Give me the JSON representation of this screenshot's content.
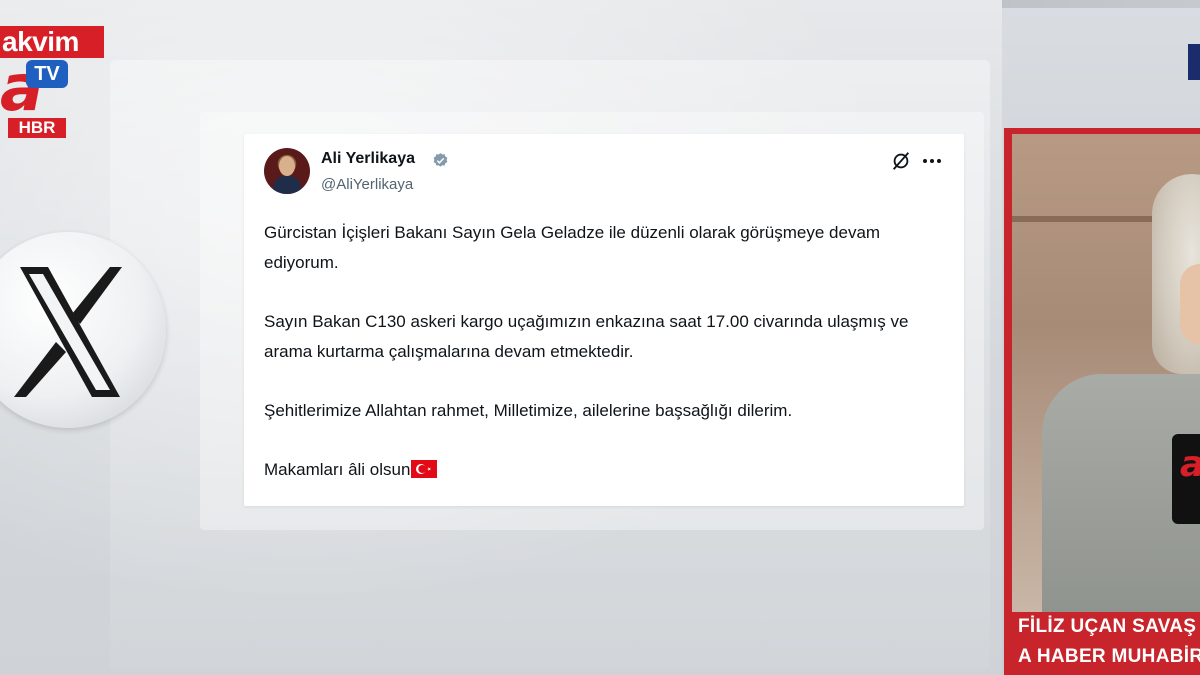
{
  "channel_logo": {
    "brand": "akvim",
    "tv": "TV",
    "letter": "a",
    "sub": "HBR"
  },
  "platform_icon": "x-logo-icon",
  "tweet": {
    "author_name": "Ali Yerlikaya",
    "author_handle": "@AliYerlikaya",
    "verified_icon": "verified-badge-icon",
    "paragraphs": [
      "Gürcistan İçişleri Bakanı Sayın Gela Geladze ile düzenli olarak görüşmeye devam ediyorum.",
      "Sayın Bakan C130 askeri kargo uçağımızın enkazına saat 17.00 civarında ulaşmış ve arama kurtarma çalışmalarına devam etmektedir.",
      "Şehitlerimize Allahtan rahmet, Milletimize, ailelerine başsağlığı dilerim.",
      "Makamları âli olsun"
    ],
    "flag_icon": "turkey-flag-icon"
  },
  "reporter": {
    "name": "FİLİZ UÇAN SAVAŞ",
    "role": "A HABER MUHABİRİ",
    "mic_logo": "a"
  },
  "colors": {
    "brand_red": "#d61f26",
    "tv_blue": "#1f5fbf"
  }
}
